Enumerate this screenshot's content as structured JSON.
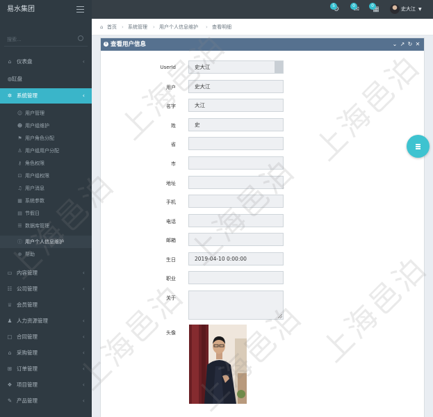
{
  "topbar": {
    "brand": "易水集团",
    "badges": [
      "5",
      "0",
      "0"
    ],
    "user_name": "史大江"
  },
  "sidebar": {
    "search_placeholder": "搜索...",
    "items_top": [
      {
        "label": "仪表盘",
        "icon": "home-icon"
      },
      {
        "label": "缸盘",
        "icon": "globe-icon"
      },
      {
        "label": "系统管理",
        "icon": "gears-icon",
        "active": true
      }
    ],
    "sub_items": [
      {
        "label": "用户管理",
        "icon": "user-icon"
      },
      {
        "label": "用户组维护",
        "icon": "users-icon"
      },
      {
        "label": "用户角色分配",
        "icon": "flag-icon"
      },
      {
        "label": "用户组用户分配",
        "icon": "user-group-icon"
      },
      {
        "label": "角色权限",
        "icon": "key-icon"
      },
      {
        "label": "用户组权限",
        "icon": "lock-icon"
      },
      {
        "label": "用户消息",
        "icon": "bell-icon"
      },
      {
        "label": "系统参数",
        "icon": "grid-icon"
      },
      {
        "label": "节假日",
        "icon": "calendar-icon"
      },
      {
        "label": "数据库管理",
        "icon": "database-icon"
      },
      {
        "label": "用户个人信息维护",
        "icon": "info-icon",
        "current": true
      },
      {
        "label": "帮助",
        "icon": "help-icon"
      }
    ],
    "items_bottom": [
      {
        "label": "内容管理",
        "icon": "book-icon"
      },
      {
        "label": "公司管理",
        "icon": "sitemap-icon"
      },
      {
        "label": "会员管理",
        "icon": "trophy-icon"
      },
      {
        "label": "人力资源管理",
        "icon": "people-icon"
      },
      {
        "label": "合同管理",
        "icon": "document-icon"
      },
      {
        "label": "采购管理",
        "icon": "bag-icon"
      },
      {
        "label": "订单管理",
        "icon": "cart-icon"
      },
      {
        "label": "项目管理",
        "icon": "cubes-icon"
      },
      {
        "label": "产品管理",
        "icon": "edit-icon"
      }
    ]
  },
  "breadcrumb": [
    "首页",
    "系统管理",
    "用户个人信息维护",
    "查看明细"
  ],
  "panel": {
    "title": "查看用户信息",
    "fields": [
      {
        "label": "UserId",
        "value": "史大江"
      },
      {
        "label": "用户",
        "value": "史大江"
      },
      {
        "label": "名字",
        "value": "大江"
      },
      {
        "label": "姓",
        "value": "史"
      },
      {
        "label": "省",
        "value": ""
      },
      {
        "label": "市",
        "value": ""
      },
      {
        "label": "地址",
        "value": ""
      },
      {
        "label": "手机",
        "value": ""
      },
      {
        "label": "电话",
        "value": ""
      },
      {
        "label": "邮箱",
        "value": ""
      },
      {
        "label": "生日",
        "value": "2019-04-10 0:00:00"
      },
      {
        "label": "职业",
        "value": ""
      },
      {
        "label": "关于",
        "value": ""
      }
    ],
    "avatar_label": "头像"
  },
  "watermark": "上海邑泊",
  "colors": {
    "accent": "#3ab5c9",
    "panel_header": "#56718f",
    "sidebar": "#2f3a42"
  }
}
